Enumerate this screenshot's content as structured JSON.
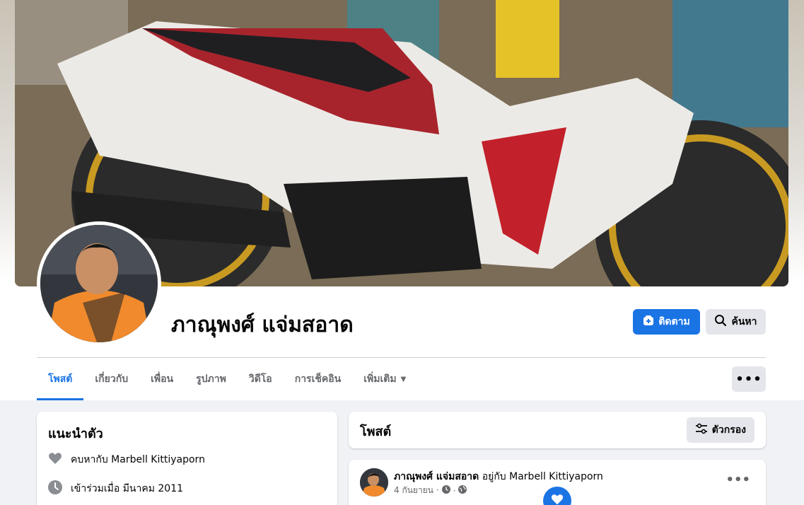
{
  "profile": {
    "name": "ภาณุพงศ์ แจ่มสอาด",
    "follow_label": "ติดตาม",
    "search_label": "ค้นหา"
  },
  "tabs": [
    {
      "label": "โพสต์",
      "active": true
    },
    {
      "label": "เกี่ยวกับ"
    },
    {
      "label": "เพื่อน"
    },
    {
      "label": "รูปภาพ"
    },
    {
      "label": "วิดีโอ"
    },
    {
      "label": "การเช็คอิน"
    },
    {
      "label": "เพิ่มเติม"
    }
  ],
  "more_button": "•••",
  "intro": {
    "title": "แนะนำตัว",
    "items": [
      {
        "icon": "heart-icon",
        "text": "คบหากับ Marbell Kittiyaporn"
      },
      {
        "icon": "clock-icon",
        "text": "เข้าร่วมเมื่อ มีนาคม 2011"
      }
    ]
  },
  "posts": {
    "title": "โพสต์",
    "filter_label": "ตัวกรอง"
  },
  "post": {
    "author": "ภาณุพงศ์ แจ่มสอาด",
    "with_text": "อยู่กับ Marbell Kittiyaporn",
    "date": "4 กันยายน ·",
    "more": "•••"
  },
  "colors": {
    "accent": "#1b74e4",
    "page_bg": "#f0f2f5",
    "secondary_text": "#65676b",
    "button_gray": "#e4e6eb"
  }
}
